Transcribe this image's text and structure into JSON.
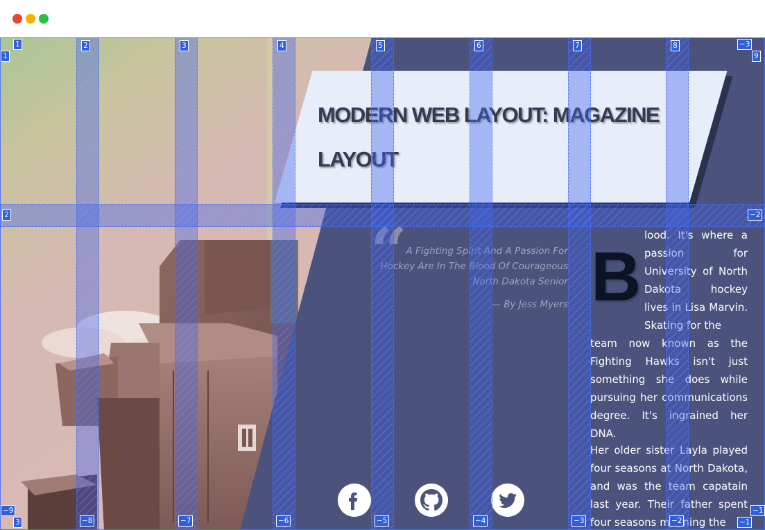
{
  "window": {
    "buttons": [
      {
        "name": "close",
        "color": "#e8452f"
      },
      {
        "name": "minimize",
        "color": "#f0b400"
      },
      {
        "name": "zoom",
        "color": "#29c13f"
      }
    ]
  },
  "header": {
    "title": "MODERN WEB LAYOUT: MAGAZINE LAYOUT"
  },
  "pullquote": {
    "icon": "quote-icon",
    "text": "A Fighting Spirit And A Passion For Hockey Are In The Blood Of Courageous North Dakota Senior",
    "byline": "— By Jess Myers"
  },
  "article": {
    "dropcap": "B",
    "para1_indented": "lood. It's where a passion for University of North Dakota hockey lives in Lisa Marvin. Skating for the",
    "para1_full": "team now known as the Fighting Hawks isn't just something she does while pursuing her communications degree. It's ingrained her DNA.",
    "para2": "Her older sister Layla played four seasons at North Dakota, and was the team capatain last year. Their father spent four seasons manning the"
  },
  "social": [
    {
      "name": "facebook",
      "icon": "facebook-icon"
    },
    {
      "name": "github",
      "icon": "github-icon"
    },
    {
      "name": "twitter",
      "icon": "twitter-icon"
    }
  ],
  "grid_overlay": {
    "color": "#2f5fd9",
    "column_labels_top": [
      "1",
      "2",
      "3",
      "4",
      "5",
      "6",
      "7",
      "8",
      "−3"
    ],
    "column_labels_bottom": [
      "3",
      "−8",
      "−7",
      "−6",
      "−5",
      "−4",
      "−3",
      "−2",
      "−1"
    ],
    "row_labels_left": [
      "1",
      "2",
      "−9"
    ],
    "row_labels_right": [
      "9",
      "−2",
      "−1"
    ]
  },
  "colors": {
    "page_bg": "#4b527c",
    "card_bg": "#e7edf9",
    "card_text": "#353a54",
    "dropcap": "#0d1224",
    "quote_text": "#9ea3bd"
  }
}
